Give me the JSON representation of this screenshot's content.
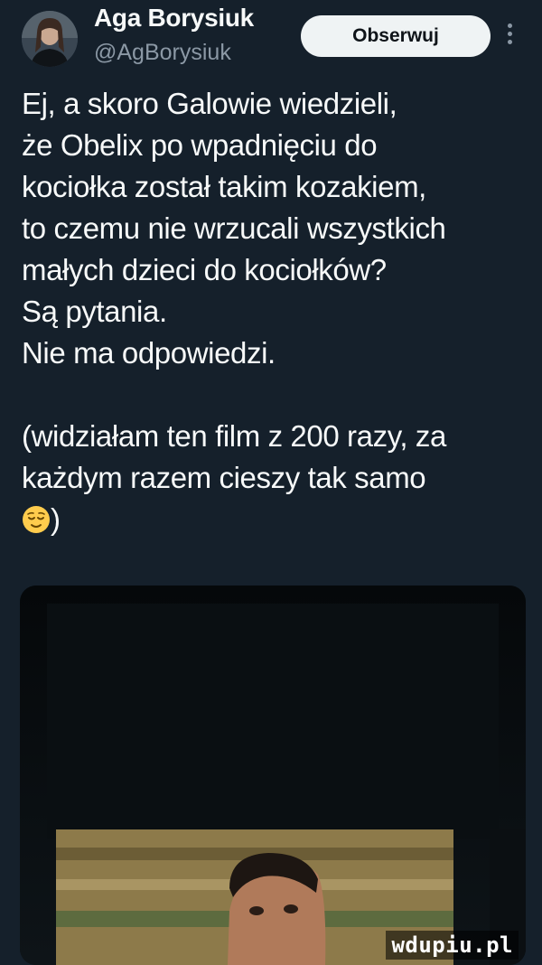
{
  "author": {
    "name": "Aga Borysiuk",
    "handle": "@AgBorysiuk",
    "avatar_icon": "profile-photo-icon"
  },
  "header": {
    "follow_label": "Obserwuj",
    "more_icon": "more-options-icon"
  },
  "tweet": {
    "lines": [
      "Ej, a skoro Galowie wiedzieli,",
      "że Obelix po wpadnięciu do",
      "kociołka został takim kozakiem,",
      "to czemu nie wrzucali wszystkich",
      "małych dzieci do kociołków?",
      "Są pytania.",
      "Nie ma odpowiedzi."
    ],
    "lines2": [
      "(widziałam ten film z 200 razy, za",
      "każdym razem cieszy tak samo"
    ],
    "closing": ")",
    "emoji": "relieved-face"
  },
  "media": {
    "watermark": "wdupiu.pl"
  },
  "colors": {
    "background": "#15202b",
    "text": "#f7f9f9",
    "secondary_text": "#8b98a5",
    "button_bg": "#eff3f4"
  }
}
